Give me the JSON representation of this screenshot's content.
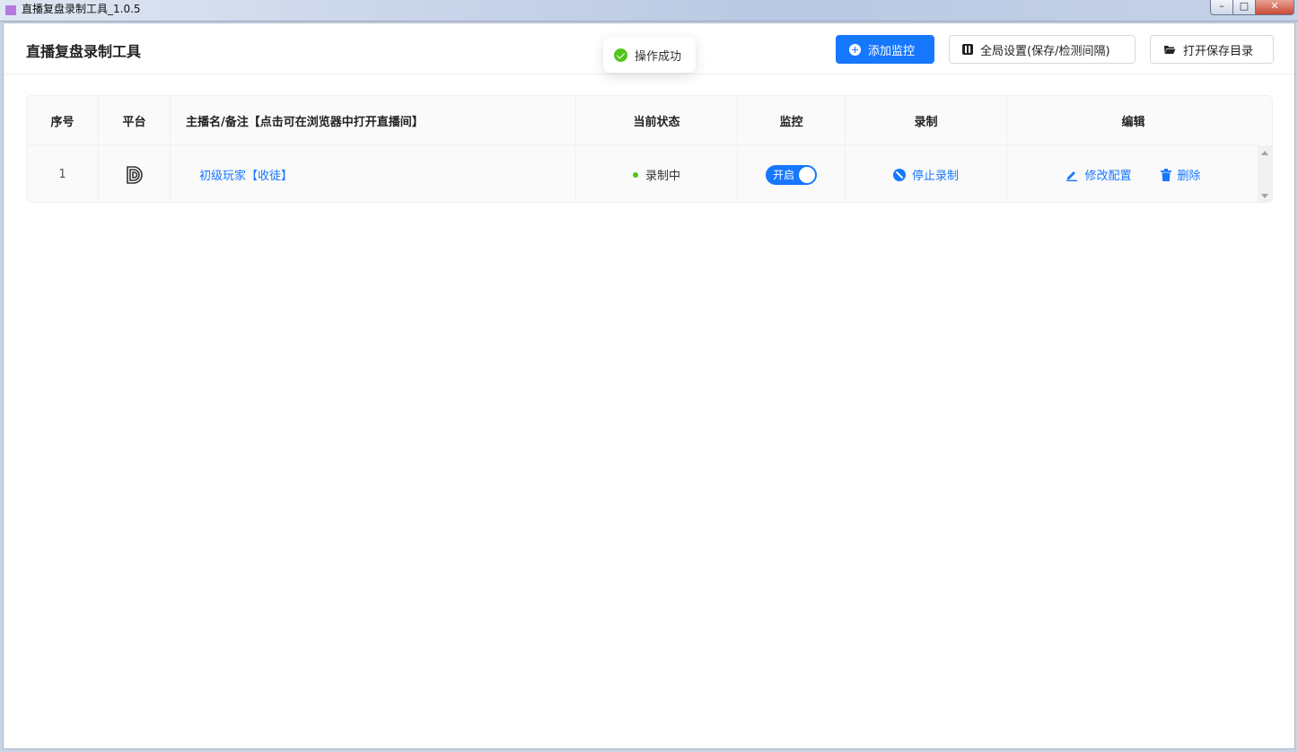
{
  "window": {
    "title": "直播复盘录制工具_1.0.5",
    "buttons": {
      "minimize": "–",
      "maximize": "□",
      "close": "✕"
    }
  },
  "header": {
    "app_title": "直播复盘录制工具",
    "add_monitor_label": "添加监控",
    "global_settings_label": "全局设置(保存/检测间隔)",
    "open_folder_label": "打开保存目录"
  },
  "toast": {
    "message": "操作成功"
  },
  "table": {
    "columns": [
      "序号",
      "平台",
      "主播名/备注【点击可在浏览器中打开直播间】",
      "当前状态",
      "监控",
      "录制",
      "编辑"
    ],
    "rows": [
      {
        "index": "1",
        "platform_icon": "douyin-style-platform-icon",
        "name": "初级玩家【收徒】",
        "status": "录制中",
        "monitor_toggle": "开启",
        "record_action": "停止录制",
        "edit_action": "修改配置",
        "delete_action": "删除"
      }
    ]
  },
  "colors": {
    "primary": "#1677ff",
    "success": "#52c41a"
  }
}
